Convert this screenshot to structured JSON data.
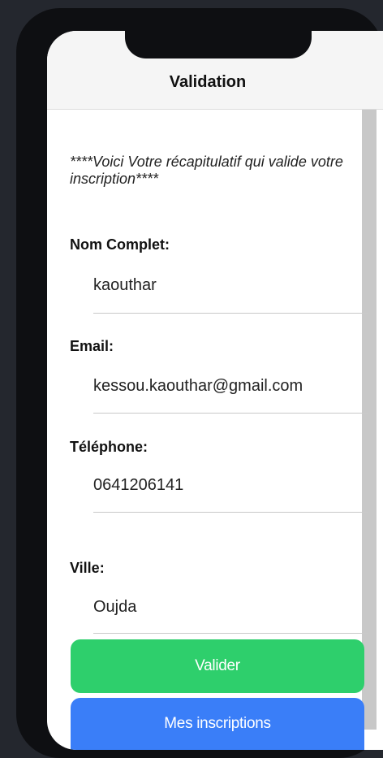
{
  "header": {
    "title": "Validation"
  },
  "intro_text": "****Voici Votre récapitulatif qui valide votre inscription****",
  "fields": [
    {
      "label": "Nom Complet:",
      "value": "kaouthar"
    },
    {
      "label": "Email:",
      "value": "kessou.kaouthar@gmail.com"
    },
    {
      "label": "Téléphone:",
      "value": "0641206141"
    },
    {
      "label": "Ville:",
      "value": "Oujda"
    }
  ],
  "buttons": {
    "valider_label": "Valider",
    "inscriptions_label": "Mes inscriptions"
  },
  "colors": {
    "valider": "#2ecf6c",
    "inscriptions": "#3a7ef8"
  }
}
